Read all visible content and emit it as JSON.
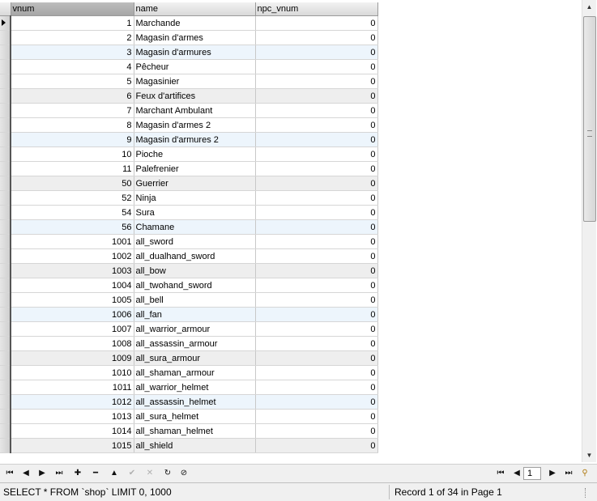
{
  "columns": [
    "vnum",
    "name",
    "npc_vnum"
  ],
  "rows": [
    {
      "vnum": "1",
      "name": "Marchande",
      "npc_vnum": "0"
    },
    {
      "vnum": "2",
      "name": "Magasin d'armes",
      "npc_vnum": "0"
    },
    {
      "vnum": "3",
      "name": "Magasin d'armures",
      "npc_vnum": "0"
    },
    {
      "vnum": "4",
      "name": "Pêcheur",
      "npc_vnum": "0"
    },
    {
      "vnum": "5",
      "name": "Magasinier",
      "npc_vnum": "0"
    },
    {
      "vnum": "6",
      "name": "Feux d'artifices",
      "npc_vnum": "0"
    },
    {
      "vnum": "7",
      "name": "Marchant Ambulant",
      "npc_vnum": "0"
    },
    {
      "vnum": "8",
      "name": "Magasin d'armes 2",
      "npc_vnum": "0"
    },
    {
      "vnum": "9",
      "name": "Magasin d'armures 2",
      "npc_vnum": "0"
    },
    {
      "vnum": "10",
      "name": "Pioche",
      "npc_vnum": "0"
    },
    {
      "vnum": "11",
      "name": "Palefrenier",
      "npc_vnum": "0"
    },
    {
      "vnum": "50",
      "name": "Guerrier",
      "npc_vnum": "0"
    },
    {
      "vnum": "52",
      "name": "Ninja",
      "npc_vnum": "0"
    },
    {
      "vnum": "54",
      "name": "Sura",
      "npc_vnum": "0"
    },
    {
      "vnum": "56",
      "name": "Chamane",
      "npc_vnum": "0"
    },
    {
      "vnum": "1001",
      "name": "all_sword",
      "npc_vnum": "0"
    },
    {
      "vnum": "1002",
      "name": "all_dualhand_sword",
      "npc_vnum": "0"
    },
    {
      "vnum": "1003",
      "name": "all_bow",
      "npc_vnum": "0"
    },
    {
      "vnum": "1004",
      "name": "all_twohand_sword",
      "npc_vnum": "0"
    },
    {
      "vnum": "1005",
      "name": "all_bell",
      "npc_vnum": "0"
    },
    {
      "vnum": "1006",
      "name": "all_fan",
      "npc_vnum": "0"
    },
    {
      "vnum": "1007",
      "name": "all_warrior_armour",
      "npc_vnum": "0"
    },
    {
      "vnum": "1008",
      "name": "all_assassin_armour",
      "npc_vnum": "0"
    },
    {
      "vnum": "1009",
      "name": "all_sura_armour",
      "npc_vnum": "0"
    },
    {
      "vnum": "1010",
      "name": "all_shaman_armour",
      "npc_vnum": "0"
    },
    {
      "vnum": "1011",
      "name": "all_warrior_helmet",
      "npc_vnum": "0"
    },
    {
      "vnum": "1012",
      "name": "all_assassin_helmet",
      "npc_vnum": "0"
    },
    {
      "vnum": "1013",
      "name": "all_sura_helmet",
      "npc_vnum": "0"
    },
    {
      "vnum": "1014",
      "name": "all_shaman_helmet",
      "npc_vnum": "0"
    },
    {
      "vnum": "1015",
      "name": "all_shield",
      "npc_vnum": "0"
    }
  ],
  "active_row": 0,
  "row_shading": [
    "white",
    "white",
    "alt",
    "white",
    "white",
    "gray",
    "white",
    "white",
    "alt",
    "white",
    "white",
    "gray",
    "white",
    "white",
    "alt",
    "white",
    "white",
    "gray",
    "white",
    "white",
    "alt",
    "white",
    "white",
    "gray",
    "white",
    "white",
    "alt",
    "white",
    "white",
    "gray"
  ],
  "toolbar": {
    "buttons": [
      {
        "name": "first-record-button",
        "icon": "⏮"
      },
      {
        "name": "prev-record-button",
        "icon": "◀"
      },
      {
        "name": "next-record-button",
        "icon": "▶"
      },
      {
        "name": "last-record-button",
        "icon": "⏭"
      },
      {
        "name": "insert-record-button",
        "icon": "✚"
      },
      {
        "name": "delete-record-button",
        "icon": "━"
      },
      {
        "name": "edit-record-button",
        "icon": "▲"
      },
      {
        "name": "post-edit-button",
        "icon": "✔"
      },
      {
        "name": "cancel-edit-button",
        "icon": "✕"
      },
      {
        "name": "refresh-button",
        "icon": "↻"
      },
      {
        "name": "stop-button",
        "icon": "⊘"
      }
    ],
    "pager": {
      "first_icon": "⏮",
      "prev_icon": "◀",
      "page_value": "1",
      "next_icon": "▶",
      "last_icon": "⏭",
      "filter_icon": "⚲"
    }
  },
  "status": {
    "query": "SELECT * FROM `shop` LIMIT 0, 1000",
    "record": "Record 1 of 34 in Page 1"
  },
  "colors": {
    "alt_row": "#edf5fc",
    "gray_row": "#eeeeee",
    "header": "#d9d9d9"
  }
}
